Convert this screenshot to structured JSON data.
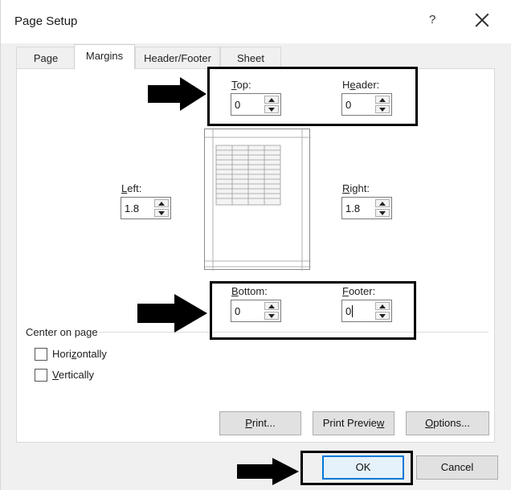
{
  "window": {
    "title": "Page Setup",
    "help_glyph": "?",
    "close_icon": "close-icon"
  },
  "tabs": [
    {
      "label": "Page",
      "active": false
    },
    {
      "label": "Margins",
      "active": true
    },
    {
      "label": "Header/Footer",
      "active": false
    },
    {
      "label": "Sheet",
      "active": false
    }
  ],
  "margins": {
    "top": {
      "mnemonic": "T",
      "rest": "op:",
      "value": "0"
    },
    "header": {
      "pre": "H",
      "mnemonic": "e",
      "rest": "ader:",
      "value": "0"
    },
    "left": {
      "mnemonic": "L",
      "rest": "eft:",
      "value": "1.8"
    },
    "right": {
      "mnemonic": "R",
      "rest": "ight:",
      "value": "1.8"
    },
    "bottom": {
      "mnemonic": "B",
      "rest": "ottom:",
      "value": "0"
    },
    "footer": {
      "mnemonic": "F",
      "rest": "ooter:",
      "value": "0"
    }
  },
  "center_on_page": {
    "label": "Center on page",
    "horizontally": {
      "pre": "Hori",
      "mnemonic": "z",
      "rest": "ontally",
      "checked": false
    },
    "vertically": {
      "pre": "",
      "mnemonic": "V",
      "rest": "ertically",
      "checked": false
    }
  },
  "panel_buttons": {
    "print": {
      "mnemonic": "P",
      "rest": "rint..."
    },
    "preview": {
      "pre": "Print Previe",
      "mnemonic": "w",
      "rest": ""
    },
    "options": {
      "mnemonic": "O",
      "rest": "ptions..."
    }
  },
  "footer_buttons": {
    "ok": "OK",
    "cancel": "Cancel"
  },
  "colors": {
    "accent": "#0078d7",
    "annotation": "#000000"
  }
}
